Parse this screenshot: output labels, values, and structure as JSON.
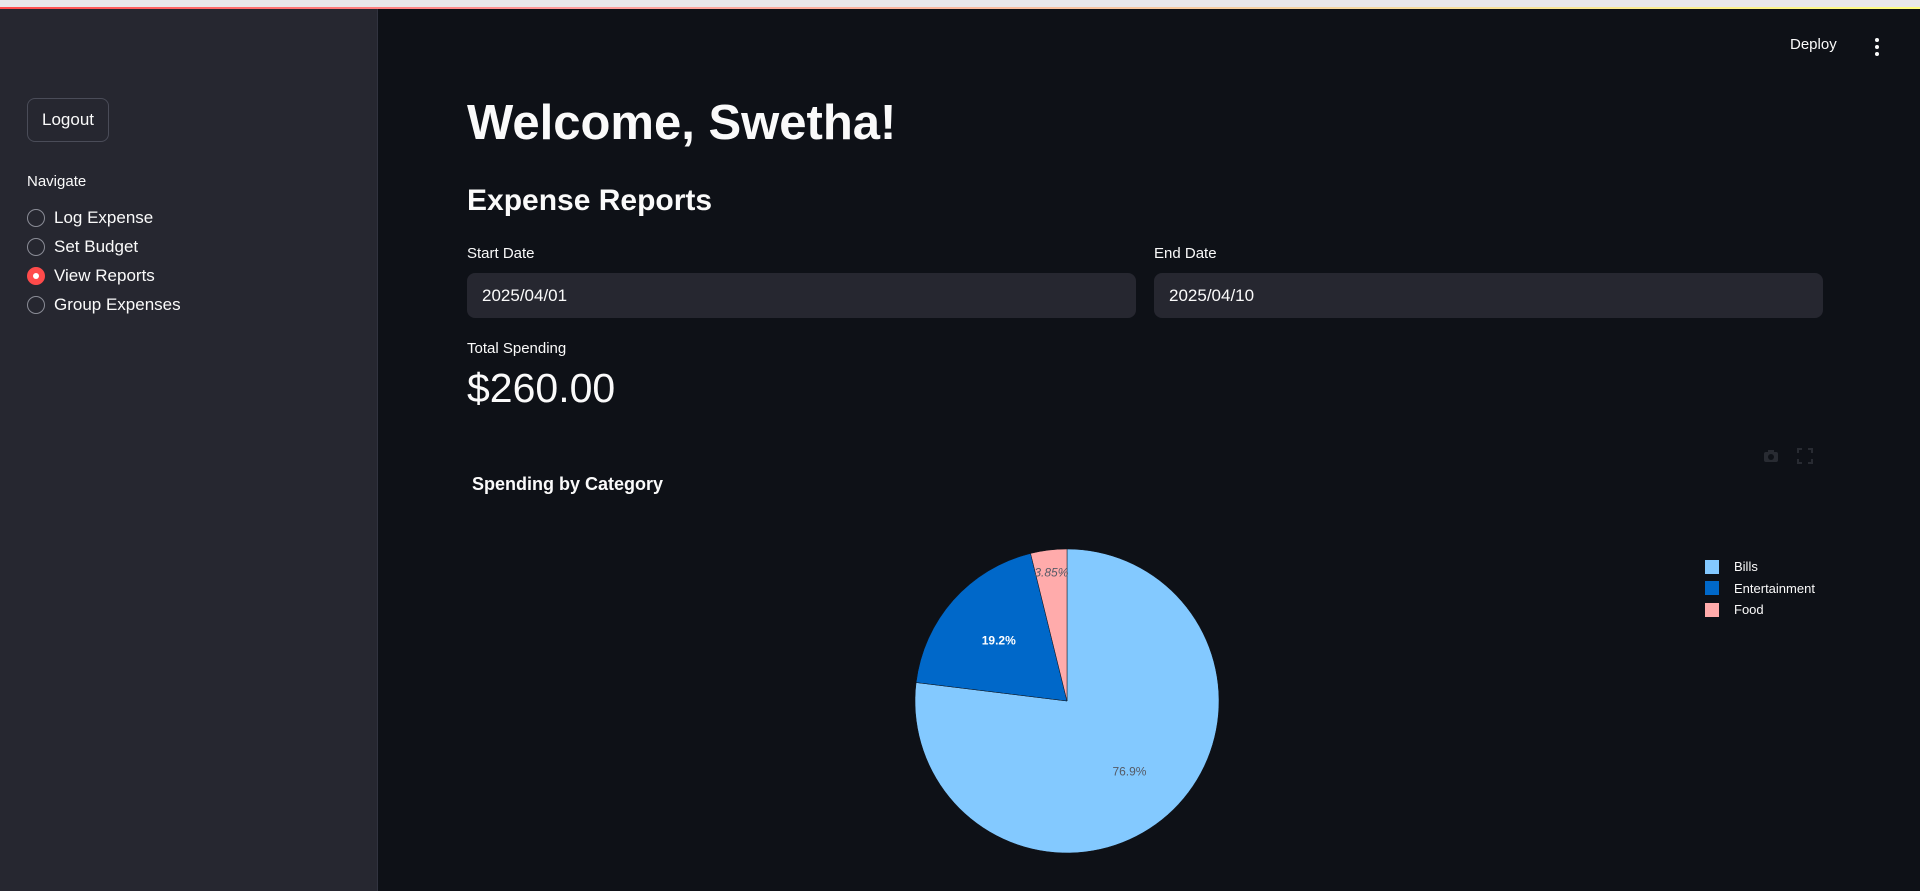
{
  "header": {
    "deploy_label": "Deploy",
    "menu_icon": "three-dots-vertical-icon"
  },
  "sidebar": {
    "logout_label": "Logout",
    "nav_label": "Navigate",
    "items": [
      {
        "label": "Log Expense",
        "selected": false
      },
      {
        "label": "Set Budget",
        "selected": false
      },
      {
        "label": "View Reports",
        "selected": true
      },
      {
        "label": "Group Expenses",
        "selected": false
      }
    ]
  },
  "main": {
    "welcome": "Welcome, Swetha!",
    "section_title": "Expense Reports",
    "start_date_label": "Start Date",
    "start_date_value": "2025/04/01",
    "end_date_label": "End Date",
    "end_date_value": "2025/04/10",
    "metric_label": "Total Spending",
    "metric_value": "$260.00"
  },
  "colors": {
    "accent": "#ff4b4b",
    "background": "#0e1117",
    "sidebar": "#262730"
  },
  "chart_data": {
    "type": "pie",
    "title": "Spending by Category",
    "categories": [
      "Bills",
      "Entertainment",
      "Food"
    ],
    "values": [
      76.9,
      19.2,
      3.85
    ],
    "labels": [
      "76.9%",
      "19.2%",
      "3.85%"
    ],
    "colors": [
      "#83c9ff",
      "#0068c9",
      "#ffabab"
    ],
    "legend_position": "top-right"
  }
}
